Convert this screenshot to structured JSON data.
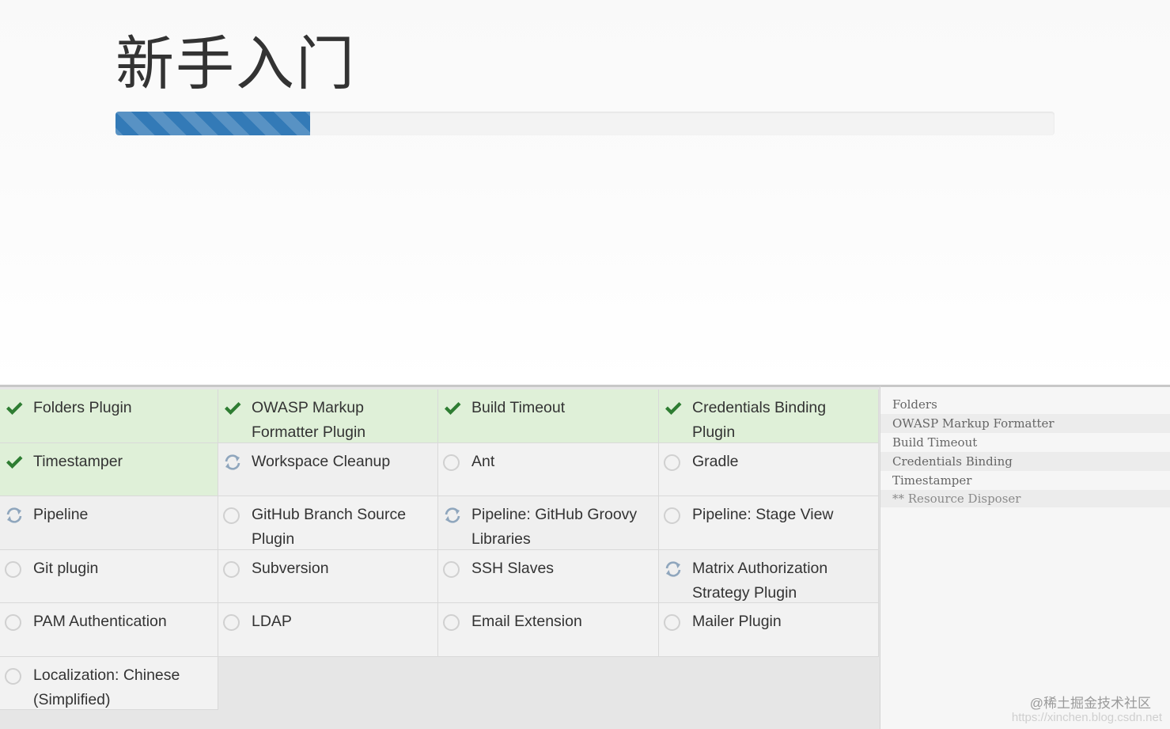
{
  "header": {
    "title": "新手入门",
    "progress_percent": 20.7
  },
  "plugins": [
    {
      "label": "Folders Plugin",
      "status": "done"
    },
    {
      "label": "OWASP Markup Formatter Plugin",
      "status": "done"
    },
    {
      "label": "Build Timeout",
      "status": "done"
    },
    {
      "label": "Credentials Binding Plugin",
      "status": "done"
    },
    {
      "label": "Timestamper",
      "status": "done"
    },
    {
      "label": "Workspace Cleanup",
      "status": "loading"
    },
    {
      "label": "Ant",
      "status": "pending"
    },
    {
      "label": "Gradle",
      "status": "pending"
    },
    {
      "label": "Pipeline",
      "status": "loading"
    },
    {
      "label": "GitHub Branch Source Plugin",
      "status": "pending"
    },
    {
      "label": "Pipeline: GitHub Groovy Libraries",
      "status": "loading"
    },
    {
      "label": "Pipeline: Stage View",
      "status": "pending"
    },
    {
      "label": "Git plugin",
      "status": "pending"
    },
    {
      "label": "Subversion",
      "status": "pending"
    },
    {
      "label": "SSH Slaves",
      "status": "pending"
    },
    {
      "label": "Matrix Authorization Strategy Plugin",
      "status": "loading"
    },
    {
      "label": "PAM Authentication",
      "status": "pending"
    },
    {
      "label": "LDAP",
      "status": "pending"
    },
    {
      "label": "Email Extension",
      "status": "pending"
    },
    {
      "label": "Mailer Plugin",
      "status": "pending"
    },
    {
      "label": "Localization: Chinese (Simplified)",
      "status": "pending"
    }
  ],
  "log": [
    "Folders",
    "OWASP Markup Formatter",
    "Build Timeout",
    "Credentials Binding",
    "Timestamper",
    "** Resource Disposer"
  ],
  "watermark": "@稀土掘金技术社区",
  "watermark_url": "https://xinchen.blog.csdn.net",
  "colors": {
    "done_bg": "#dff0d8",
    "check": "#2e7d32",
    "spinner": "#8fa6bd",
    "progress_fill": "#337ab7"
  },
  "icons": {
    "done": "check-icon",
    "loading": "refresh-icon",
    "pending": "circle-icon"
  }
}
